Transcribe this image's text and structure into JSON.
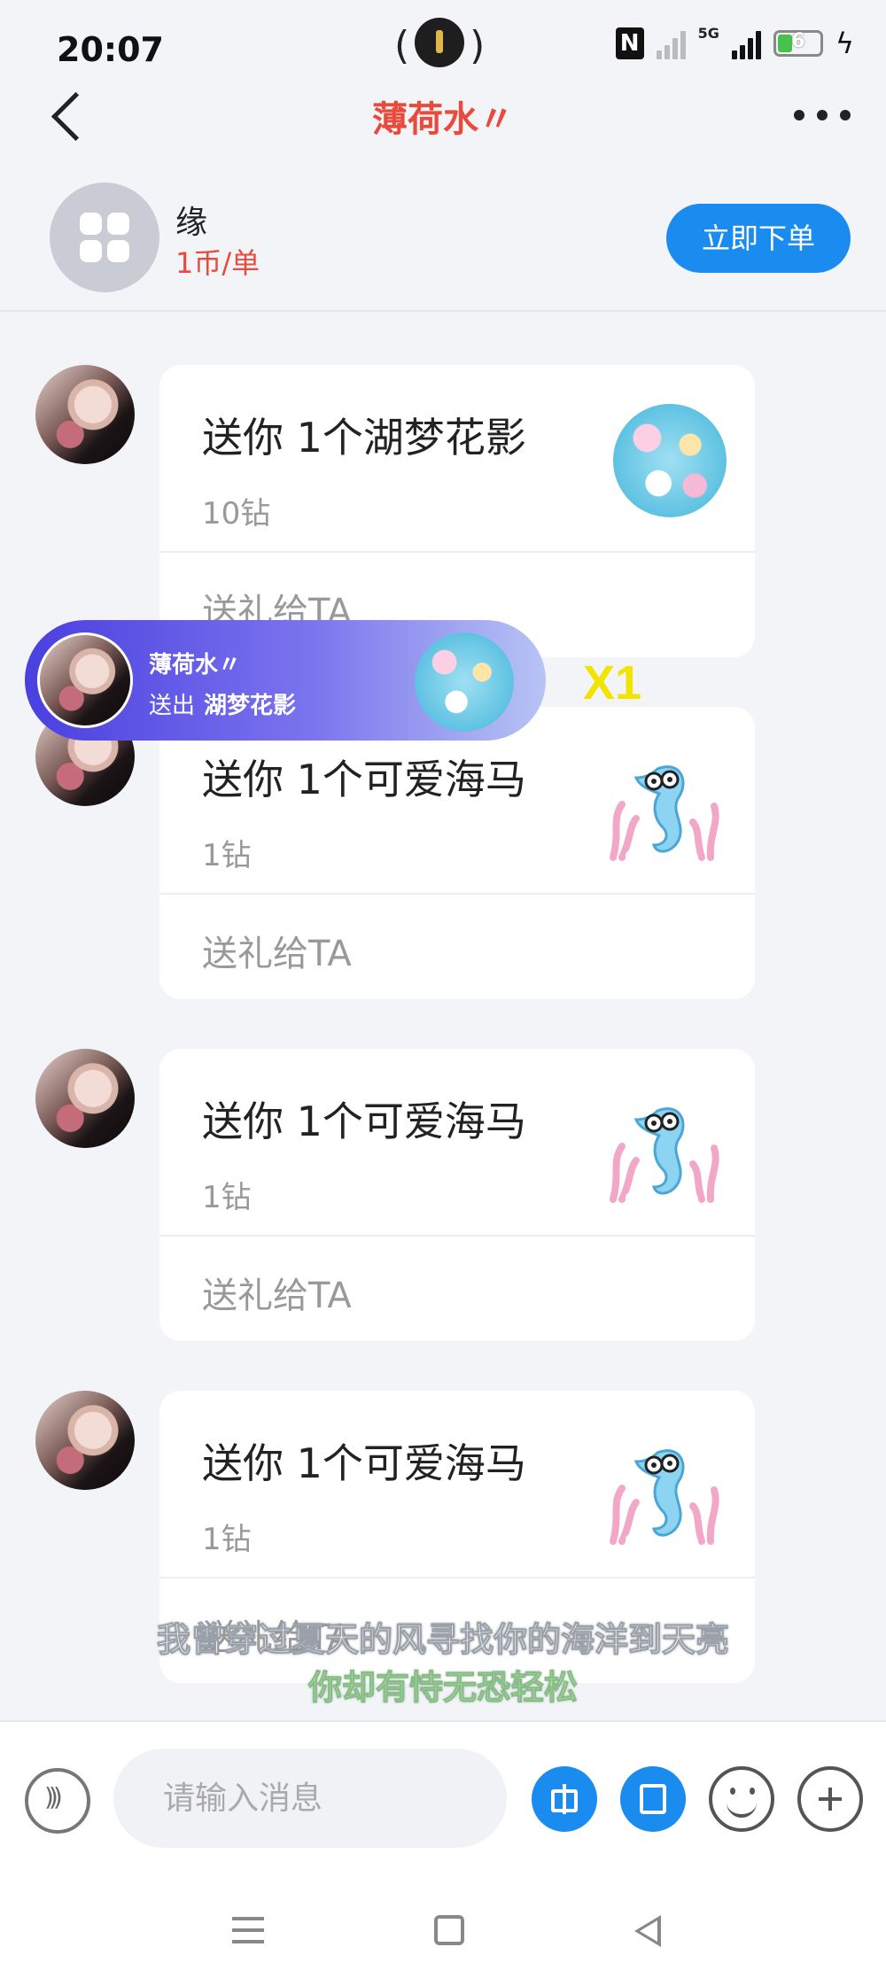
{
  "status_bar": {
    "time": "20:07",
    "battery_level": "6",
    "network": "5G"
  },
  "header": {
    "title": "薄荷水〃"
  },
  "service": {
    "name": "缘",
    "price": "1币/单",
    "order_button": "立即下单"
  },
  "messages": [
    {
      "title": "送你 1个湖梦花影",
      "cost": "10钻",
      "action": "送礼给TA",
      "gift_icon": "lake-dream-flower-icon"
    },
    {
      "title": "送你 1个可爱海马",
      "cost": "1钻",
      "action": "送礼给TA",
      "gift_icon": "cute-seahorse-icon"
    },
    {
      "title": "送你 1个可爱海马",
      "cost": "1钻",
      "action": "送礼给TA",
      "gift_icon": "cute-seahorse-icon"
    },
    {
      "title": "送你 1个可爱海马",
      "cost": "1钻",
      "action": "送礼给TA",
      "gift_icon": "cute-seahorse-icon"
    }
  ],
  "gift_banner": {
    "sender": "薄荷水〃",
    "sent_label": "送出",
    "gift_name": "湖梦花影",
    "multiplier": "X1"
  },
  "subtitles": {
    "line1": "我曾穿过夏天的风寻找你的海洋到天亮",
    "line2": "你却有恃无恐轻松"
  },
  "input_bar": {
    "placeholder": "请输入消息"
  },
  "colors": {
    "accent": "#1a8cf0",
    "title_red": "#e84a3b",
    "multiplier_yellow": "#f3e400"
  }
}
